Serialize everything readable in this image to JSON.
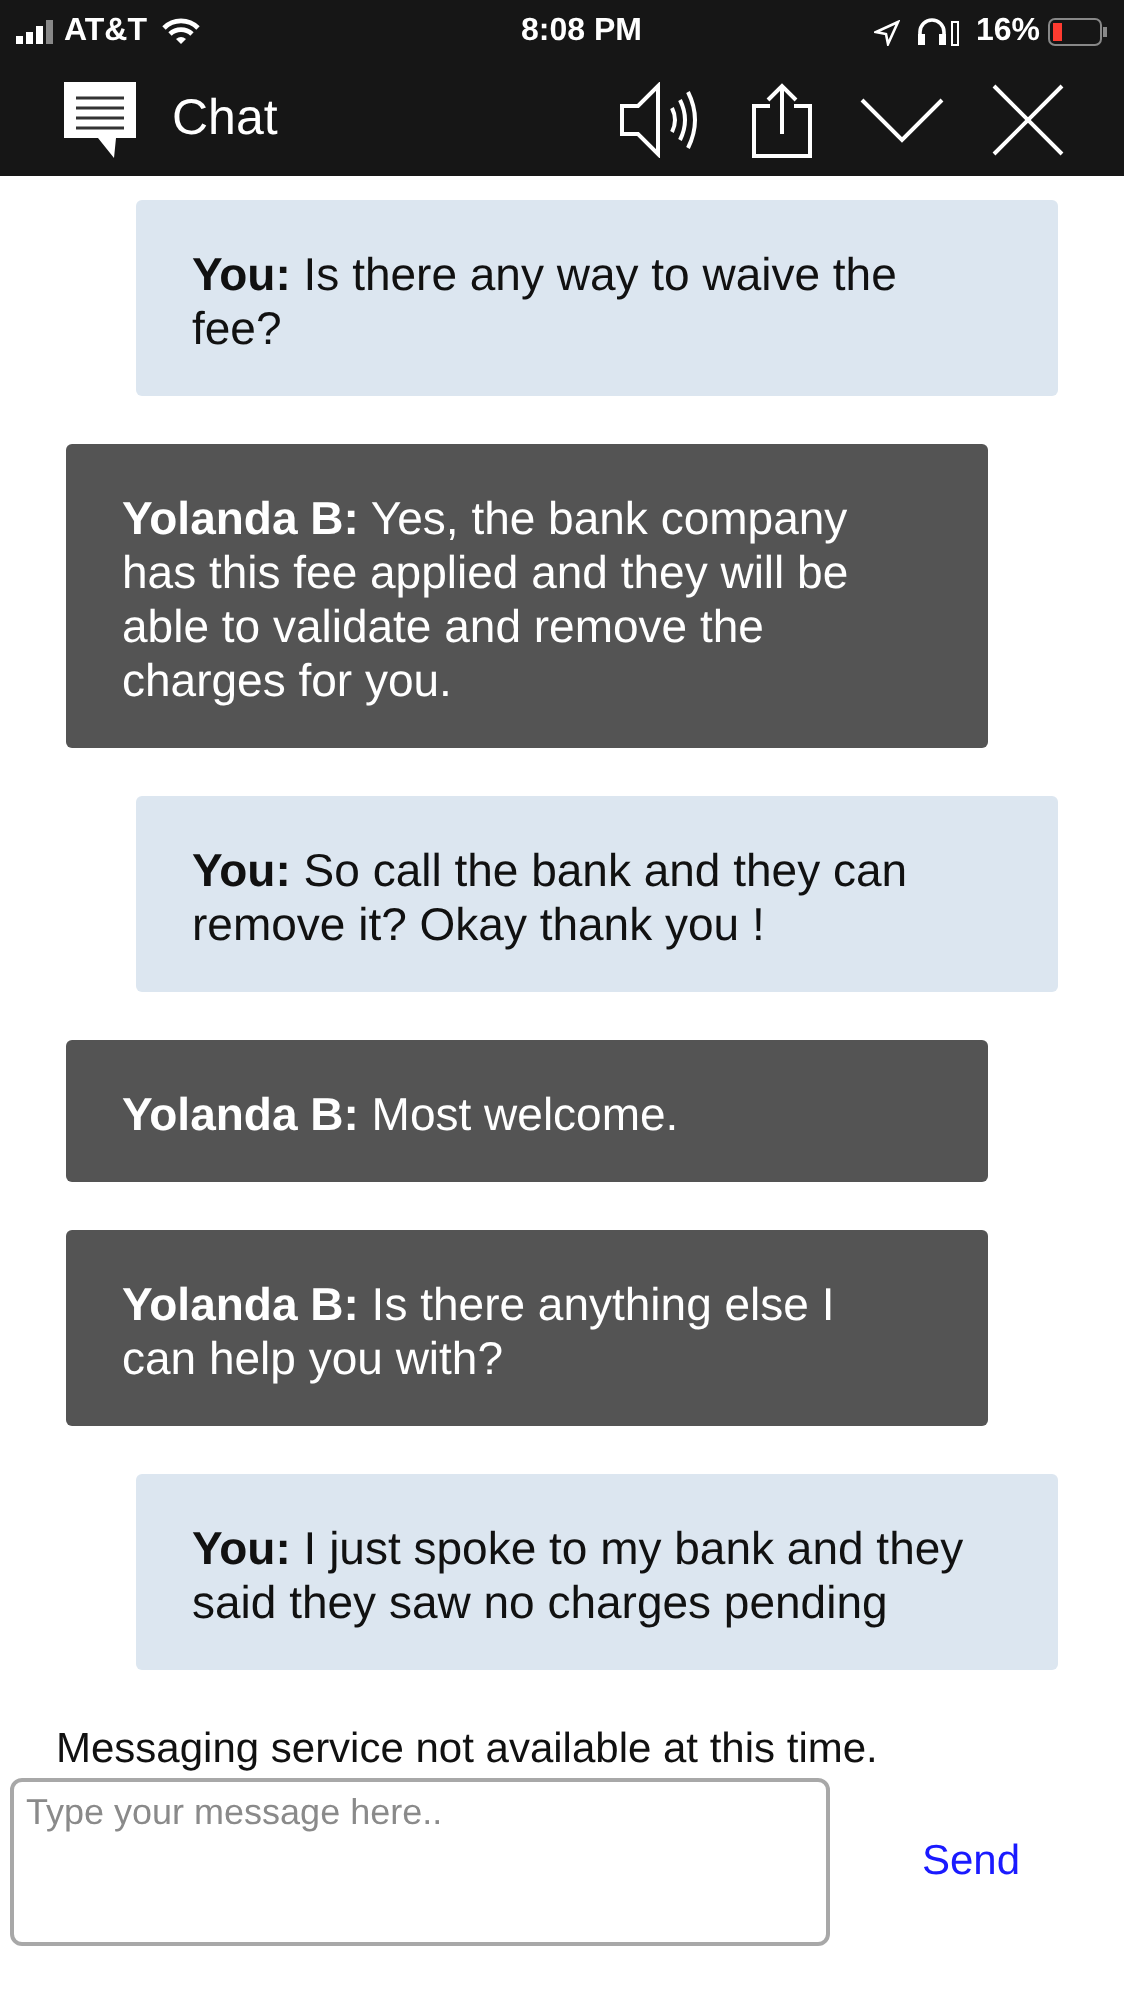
{
  "status_bar": {
    "carrier": "AT&T",
    "time": "8:08 PM",
    "battery": "16%"
  },
  "header": {
    "title": "Chat"
  },
  "messages": [
    {
      "kind": "user",
      "text": "**You:** Is there any way to waive the fee?"
    },
    {
      "kind": "agent",
      "text": "**Yolanda B:** Yes, the bank company has this fee applied and they will be able to validate and remove the charges for you."
    },
    {
      "kind": "user",
      "text": "**You:** So call the bank and they can remove it? Okay thank you !"
    },
    {
      "kind": "agent",
      "text": "**Yolanda B:** Most welcome."
    },
    {
      "kind": "agent",
      "text": "**Yolanda B:** Is there anything else I can help you with?"
    },
    {
      "kind": "user",
      "text": "**You:** I just spoke to my bank and they said they saw no charges pending"
    }
  ],
  "notice": "Messaging service not available at this time.",
  "composer": {
    "placeholder": "Type your message here..",
    "send": "Send"
  }
}
